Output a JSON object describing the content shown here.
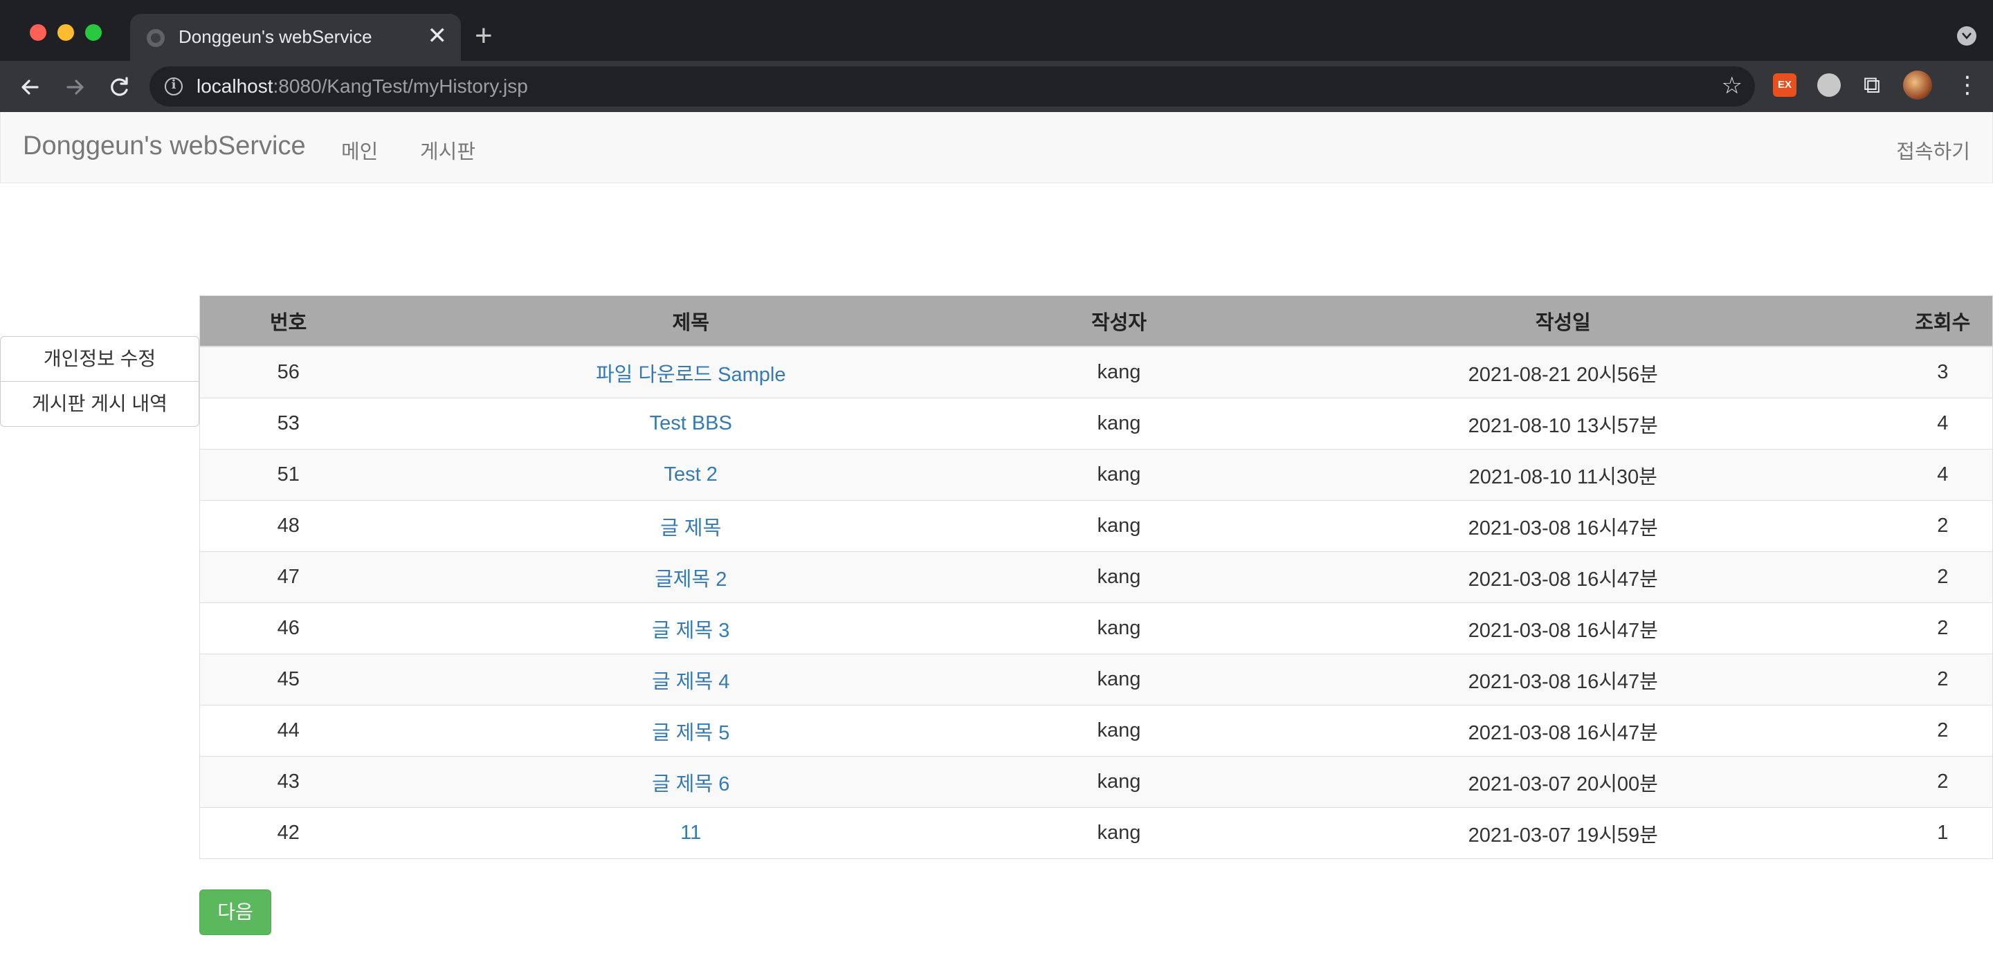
{
  "browser": {
    "tab_title": "Donggeun's webService",
    "tab_close": "✕",
    "new_tab": "+",
    "url_host": "localhost",
    "url_path": ":8080/KangTest/myHistory.jsp",
    "extension_label": "EX"
  },
  "navbar": {
    "brand": "Donggeun's webService",
    "links": [
      "메인",
      "게시판"
    ],
    "login": "접속하기"
  },
  "sidebar": {
    "items": [
      "개인정보 수정",
      "게시판 게시 내역"
    ]
  },
  "table": {
    "headers": [
      "번호",
      "제목",
      "작성자",
      "작성일",
      "조회수"
    ],
    "rows": [
      {
        "num": "56",
        "title": "파일 다운로드 Sample",
        "author": "kang",
        "date": "2021-08-21 20시56분",
        "views": "3"
      },
      {
        "num": "53",
        "title": "Test BBS",
        "author": "kang",
        "date": "2021-08-10 13시57분",
        "views": "4"
      },
      {
        "num": "51",
        "title": "Test 2",
        "author": "kang",
        "date": "2021-08-10 11시30분",
        "views": "4"
      },
      {
        "num": "48",
        "title": "글 제목",
        "author": "kang",
        "date": "2021-03-08 16시47분",
        "views": "2"
      },
      {
        "num": "47",
        "title": "글제목 2",
        "author": "kang",
        "date": "2021-03-08 16시47분",
        "views": "2"
      },
      {
        "num": "46",
        "title": "글 제목 3",
        "author": "kang",
        "date": "2021-03-08 16시47분",
        "views": "2"
      },
      {
        "num": "45",
        "title": "글 제목 4",
        "author": "kang",
        "date": "2021-03-08 16시47분",
        "views": "2"
      },
      {
        "num": "44",
        "title": "글 제목 5",
        "author": "kang",
        "date": "2021-03-08 16시47분",
        "views": "2"
      },
      {
        "num": "43",
        "title": "글 제목 6",
        "author": "kang",
        "date": "2021-03-07 20시00분",
        "views": "2"
      },
      {
        "num": "42",
        "title": "11",
        "author": "kang",
        "date": "2021-03-07 19시59분",
        "views": "1"
      }
    ]
  },
  "pagination": {
    "next_label": "다음"
  },
  "colors": {
    "header_bg": "#aaaaaa",
    "link": "#337ab7",
    "next_button": "#5cb85c"
  }
}
